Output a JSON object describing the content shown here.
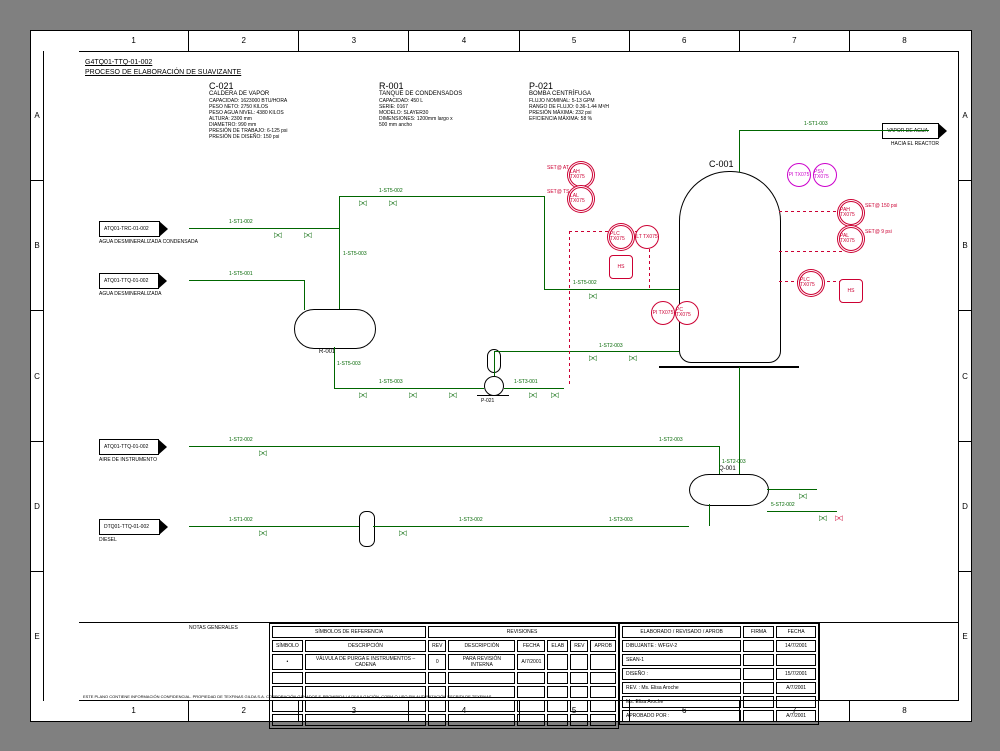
{
  "drawing_number": "G4TQ01-TTQ-01-002",
  "drawing_title": "PROCESO DE ELABORACIÓN DE SUAVIZANTE",
  "grid": {
    "cols": [
      "1",
      "2",
      "3",
      "4",
      "5",
      "6",
      "7",
      "8"
    ],
    "rows": [
      "A",
      "B",
      "C",
      "D",
      "E"
    ]
  },
  "equipment": {
    "c021": {
      "tag": "C-021",
      "desc": "CALDERA DE VAPOR",
      "lines": [
        "CAPACIDAD: 1623000 BTU/HORA",
        "PESO NETO: 2750 KILOS",
        "PESO AGUA NIVEL: 4380 KILOS",
        "ALTURA: 2300 mm",
        "DIAMETRO: 990 mm",
        "PRESIÓN DE TRABAJO: 6-125 psi",
        "PRESIÓN DE DISEÑO: 150 psi"
      ]
    },
    "r001": {
      "tag": "R-001",
      "desc": "TANQUE DE CONDENSADOS",
      "lines": [
        "CAPACIDAD: 450 L",
        "SERIE: 0167",
        "MODELO: SLAYER30",
        "DIMENSIONES: 1200mm largo x",
        "500 mm ancho"
      ]
    },
    "p021": {
      "tag": "P-021",
      "desc": "BOMBA CENTRÍFUGA",
      "lines": [
        "FLUJO NOMINAL: 5-13 GPM",
        "RANGO DE FLUJO: 0.36-1.44 M³/H",
        "PRESIÓN MÁXIMA: 232 psi",
        "EFICIENCIA MÁXIMA: 58 %"
      ]
    }
  },
  "vessels": {
    "c001_label": "C-001",
    "r001_label": "R-001",
    "p021_label": "P-021",
    "q001_label": "Q-001"
  },
  "streams": {
    "out_vapor": {
      "line1": "VAPOR DE AGUA",
      "line2": "HACIA EL REACTOR"
    },
    "in_agua_cond": {
      "tag": "ATQ01-TRC-01-002",
      "label": "AGUA DESMINERALIZADA CONDENSADA"
    },
    "in_agua": {
      "tag": "ATQ01-TTQ-01-002",
      "label": "AGUA DESMINERALIZADA"
    },
    "in_aire": {
      "tag": "ATQ01-TTQ-01-002",
      "label": "AIRE DE INSTRUMENTO"
    },
    "in_diesel": {
      "tag": "DTQ01-TTQ-01-002",
      "label": "DIESEL"
    }
  },
  "line_numbers": {
    "l1": "1-ST1-002",
    "l2": "1-ST5-001",
    "l3": "1-ST5-003",
    "l4": "1-ST5-002",
    "l5": "1-ST2-002",
    "l6": "1-ST2-003",
    "l7": "5-ST2-002",
    "l8": "1-ST3-001",
    "l9": "1-ST3-002",
    "l10": "1-ST3-003",
    "l11": "1-ST1-003"
  },
  "instruments": {
    "lah": "LAH TX075",
    "lal": "LAL TX075",
    "plc1": "PLC TX075",
    "lt": "LT TX075",
    "hs1": "HS",
    "pi_mag": "PI TX075",
    "psv_mag": "PSV TX075",
    "pah": "PAH TX075",
    "pal": "PAL TX075",
    "plc2": "PLC TX075",
    "hs2": "HS",
    "pi": "PI TX075",
    "pc": "PC TX075",
    "set_at": "SET@ AT",
    "set_ts": "SET@ TS",
    "set_150": "SET@ 150 psi",
    "set_9": "SET@ 9 psi"
  },
  "title_block": {
    "notes_header": "NOTAS GENERALES",
    "symbols_header": "SÍMBOLOS DE REFERENCIA",
    "revisions_header": "REVISIONES",
    "rev_dwg_header": "ELABORADO / REVISADO / APROB",
    "firma": "FIRMA",
    "fecha": "FECHA",
    "sym_cols": [
      "SÍMBOLO",
      "DESCRIPCIÓN",
      "REV",
      "DESCRIPCIÓN",
      "FECHA",
      "ELAB",
      "REV",
      "APROB"
    ],
    "sym_row": [
      "•",
      "VÁLVULA DE PURGA E INSTRUMENTOS – CADENA",
      "0",
      "PARA REVISIÓN INTERNA",
      "A/7/2001",
      "",
      "",
      ""
    ],
    "approvals": [
      {
        "label": "DIBUJANTE :",
        "value": "WFGV-2",
        "date": "14/7/2001"
      },
      {
        "label": "",
        "value": "SEAN-1",
        "date": ""
      },
      {
        "label": "DISEÑO :",
        "value": "",
        "date": "15/7/2001"
      },
      {
        "label": "REV. :",
        "value": "Ms. Elisa Aroche",
        "date": "A/7/2001"
      },
      {
        "label": "",
        "value": "Ms. Elisa Aroche",
        "date": ""
      },
      {
        "label": "APROBADO POR :",
        "value": "",
        "date": "A/7/2001"
      }
    ],
    "disclaimer": "ESTE PLANO CONTIENE INFORMACIÓN CONFIDENCIAL. PROPIEDAD DE TEXFINAS GILDA S.A. CORPORACIÓN GANADOS F. PROHIBIDA LA DIVULGACIÓN, COPIA O USO SIN AUTORIZACIÓN ESCRITA DE TEXFINAS."
  }
}
